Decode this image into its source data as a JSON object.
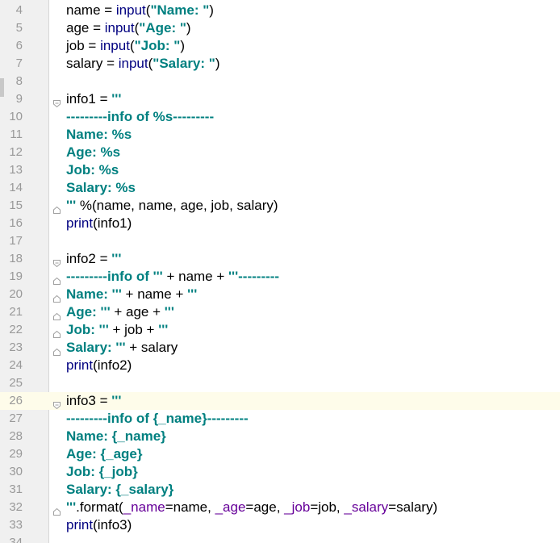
{
  "editor": {
    "current_line": 26,
    "lines": [
      {
        "n": "4",
        "fold": "none",
        "tokens": [
          {
            "c": "plain",
            "t": "name = "
          },
          {
            "c": "builtin",
            "t": "input"
          },
          {
            "c": "plain",
            "t": "("
          },
          {
            "c": "str",
            "t": "\"Name: \""
          },
          {
            "c": "plain",
            "t": ")"
          }
        ]
      },
      {
        "n": "5",
        "fold": "none",
        "tokens": [
          {
            "c": "plain",
            "t": "age = "
          },
          {
            "c": "builtin",
            "t": "input"
          },
          {
            "c": "plain",
            "t": "("
          },
          {
            "c": "str",
            "t": "\"Age: \""
          },
          {
            "c": "plain",
            "t": ")"
          }
        ]
      },
      {
        "n": "6",
        "fold": "none",
        "tokens": [
          {
            "c": "plain",
            "t": "job = "
          },
          {
            "c": "builtin",
            "t": "input"
          },
          {
            "c": "plain",
            "t": "("
          },
          {
            "c": "str",
            "t": "\"Job: \""
          },
          {
            "c": "plain",
            "t": ")"
          }
        ]
      },
      {
        "n": "7",
        "fold": "none",
        "tokens": [
          {
            "c": "plain",
            "t": "salary = "
          },
          {
            "c": "builtin",
            "t": "input"
          },
          {
            "c": "plain",
            "t": "("
          },
          {
            "c": "str",
            "t": "\"Salary: \""
          },
          {
            "c": "plain",
            "t": ")"
          }
        ]
      },
      {
        "n": "8",
        "fold": "none",
        "tokens": []
      },
      {
        "n": "9",
        "fold": "open",
        "tokens": [
          {
            "c": "plain",
            "t": "info1 = "
          },
          {
            "c": "str",
            "t": "'''"
          }
        ]
      },
      {
        "n": "10",
        "fold": "none",
        "tokens": [
          {
            "c": "str",
            "t": "---------info of %s---------"
          }
        ]
      },
      {
        "n": "11",
        "fold": "none",
        "tokens": [
          {
            "c": "str",
            "t": "Name: %s"
          }
        ]
      },
      {
        "n": "12",
        "fold": "none",
        "tokens": [
          {
            "c": "str",
            "t": "Age: %s"
          }
        ]
      },
      {
        "n": "13",
        "fold": "none",
        "tokens": [
          {
            "c": "str",
            "t": "Job: %s"
          }
        ]
      },
      {
        "n": "14",
        "fold": "none",
        "tokens": [
          {
            "c": "str",
            "t": "Salary: %s"
          }
        ]
      },
      {
        "n": "15",
        "fold": "close",
        "tokens": [
          {
            "c": "str",
            "t": "'''"
          },
          {
            "c": "plain",
            "t": " %(name, name, age, job, salary)"
          }
        ]
      },
      {
        "n": "16",
        "fold": "none",
        "tokens": [
          {
            "c": "builtin",
            "t": "print"
          },
          {
            "c": "plain",
            "t": "(info1)"
          }
        ]
      },
      {
        "n": "17",
        "fold": "none",
        "tokens": []
      },
      {
        "n": "18",
        "fold": "open",
        "tokens": [
          {
            "c": "plain",
            "t": "info2 = "
          },
          {
            "c": "str",
            "t": "'''"
          }
        ]
      },
      {
        "n": "19",
        "fold": "close",
        "tokens": [
          {
            "c": "str",
            "t": "---------info of '''"
          },
          {
            "c": "plain",
            "t": " + name + "
          },
          {
            "c": "str",
            "t": "'''---------"
          }
        ]
      },
      {
        "n": "20",
        "fold": "close",
        "tokens": [
          {
            "c": "str",
            "t": "Name: '''"
          },
          {
            "c": "plain",
            "t": " + name + "
          },
          {
            "c": "str",
            "t": "'''"
          }
        ]
      },
      {
        "n": "21",
        "fold": "close",
        "tokens": [
          {
            "c": "str",
            "t": "Age: '''"
          },
          {
            "c": "plain",
            "t": " + age + "
          },
          {
            "c": "str",
            "t": "'''"
          }
        ]
      },
      {
        "n": "22",
        "fold": "close",
        "tokens": [
          {
            "c": "str",
            "t": "Job: '''"
          },
          {
            "c": "plain",
            "t": " + job + "
          },
          {
            "c": "str",
            "t": "'''"
          }
        ]
      },
      {
        "n": "23",
        "fold": "close",
        "tokens": [
          {
            "c": "str",
            "t": "Salary: '''"
          },
          {
            "c": "plain",
            "t": " + salary"
          }
        ]
      },
      {
        "n": "24",
        "fold": "none",
        "tokens": [
          {
            "c": "builtin",
            "t": "print"
          },
          {
            "c": "plain",
            "t": "(info2)"
          }
        ]
      },
      {
        "n": "25",
        "fold": "none",
        "tokens": []
      },
      {
        "n": "26",
        "fold": "open",
        "tokens": [
          {
            "c": "plain",
            "t": "info3 = "
          },
          {
            "c": "str",
            "t": "'''"
          }
        ]
      },
      {
        "n": "27",
        "fold": "none",
        "tokens": [
          {
            "c": "str",
            "t": "---------info of {_name}---------"
          }
        ]
      },
      {
        "n": "28",
        "fold": "none",
        "tokens": [
          {
            "c": "str",
            "t": "Name: {_name}"
          }
        ]
      },
      {
        "n": "29",
        "fold": "none",
        "tokens": [
          {
            "c": "str",
            "t": "Age: {_age}"
          }
        ]
      },
      {
        "n": "30",
        "fold": "none",
        "tokens": [
          {
            "c": "str",
            "t": "Job: {_job}"
          }
        ]
      },
      {
        "n": "31",
        "fold": "none",
        "tokens": [
          {
            "c": "str",
            "t": "Salary: {_salary}"
          }
        ]
      },
      {
        "n": "32",
        "fold": "close",
        "tokens": [
          {
            "c": "str",
            "t": "'''"
          },
          {
            "c": "plain",
            "t": ".format("
          },
          {
            "c": "kw",
            "t": "_name"
          },
          {
            "c": "plain",
            "t": "=name, "
          },
          {
            "c": "kw",
            "t": "_age"
          },
          {
            "c": "plain",
            "t": "=age, "
          },
          {
            "c": "kw",
            "t": "_job"
          },
          {
            "c": "plain",
            "t": "=job, "
          },
          {
            "c": "kw",
            "t": "_salary"
          },
          {
            "c": "plain",
            "t": "=salary)"
          }
        ]
      },
      {
        "n": "33",
        "fold": "none",
        "tokens": [
          {
            "c": "builtin",
            "t": "print"
          },
          {
            "c": "plain",
            "t": "(info3)"
          }
        ]
      },
      {
        "n": "34",
        "fold": "none",
        "tokens": []
      }
    ]
  },
  "colors": {
    "string": "#008080",
    "builtin": "#000080",
    "keyword_arg": "#660099",
    "plain": "#000000",
    "line_number": "#999999",
    "current_line_bg": "#fefcea",
    "gutter_bg": "#f0f0f0"
  },
  "icons": {
    "fold_open": "fold-open-icon",
    "fold_close": "fold-close-icon"
  }
}
